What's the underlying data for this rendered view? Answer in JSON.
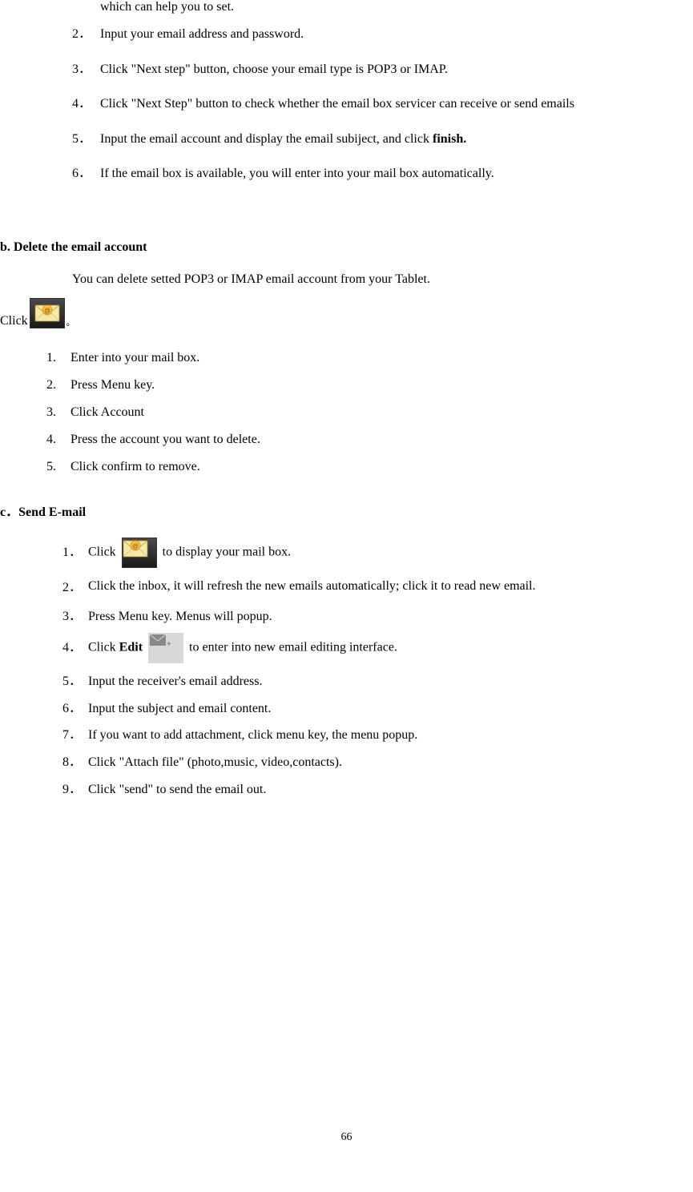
{
  "frag_line": "which can help you to set.",
  "steps_a": [
    {
      "n": "2．",
      "t": "Input your email address and password."
    },
    {
      "n": "3．",
      "t": "Click \"Next step\" button, choose your email type is POP3 or IMAP."
    },
    {
      "n": "4．",
      "t": "Click \"Next Step\" button to check whether the email box servicer can receive or send emails"
    },
    {
      "n": "5．",
      "t_pre": "Input the email account and display the email subiject, and click ",
      "bold": "finish."
    },
    {
      "n": "6．",
      "t": "If the email box is available, you will enter into your mail box automatically."
    }
  ],
  "section_b_title": "b. Delete the email account",
  "section_b_para": "You can delete setted POP3 or IMAP email account from your Tablet.",
  "click_label": "Click",
  "steps_b": [
    {
      "n": "1.",
      "t": "Enter into your mail box."
    },
    {
      "n": "2.",
      "t": "Press Menu key."
    },
    {
      "n": "3.",
      "t": "Click Account"
    },
    {
      "n": "4.",
      "t": "Press the account you want to delete."
    },
    {
      "n": "5.",
      "t": "Click confirm to remove."
    }
  ],
  "section_c_prefix": "c．",
  "section_c_title": "Send E-mail",
  "steps_c": {
    "s1_n": "1．",
    "s1_pre": "Click ",
    "s1_post": " to display your mail box.",
    "s2_n": "2．",
    "s2_t": "Click the inbox, it will refresh the new emails automatically; click it to read new email.",
    "s3_n": "3．",
    "s3_t": "Press Menu key. Menus will popup.",
    "s4_n": "4．",
    "s4_pre": "Click ",
    "s4_bold": "Edit",
    "s4_post": " to enter into new email editing interface.",
    "s5_n": "5．",
    "s5_t": "Input the receiver's email address.",
    "s6_n": "6．",
    "s6_t": "Input the subject and email content.",
    "s7_n": "7．",
    "s7_t": "If you want to add attachment, click menu key, the menu popup.",
    "s8_n": "8．",
    "s8_t": "Click \"Attach file\" (photo,music, video,contacts).",
    "s9_n": "9．",
    "s9_t": "Click \"send\" to send the email out."
  },
  "page_number": "66",
  "period_cn": "。"
}
